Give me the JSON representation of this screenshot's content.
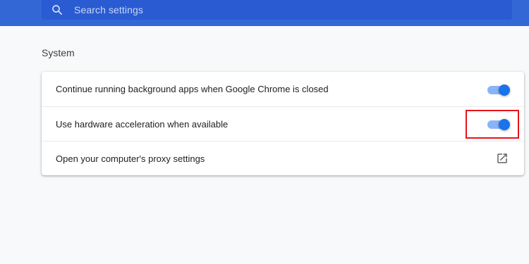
{
  "header": {
    "search_placeholder": "Search settings",
    "search_icon": "search-icon"
  },
  "section": {
    "title": "System"
  },
  "settings": [
    {
      "label": "Continue running background apps when Google Chrome is closed",
      "control": "toggle",
      "enabled": true
    },
    {
      "label": "Use hardware acceleration when available",
      "control": "toggle",
      "enabled": true,
      "highlighted": true
    },
    {
      "label": "Open your computer's proxy settings",
      "control": "external-link",
      "icon": "open-in-new-icon"
    }
  ],
  "colors": {
    "header_bg": "#3367d6",
    "accent": "#1a73e8",
    "toggle_track": "#8ab4f8",
    "highlight_border": "#e8141b"
  }
}
